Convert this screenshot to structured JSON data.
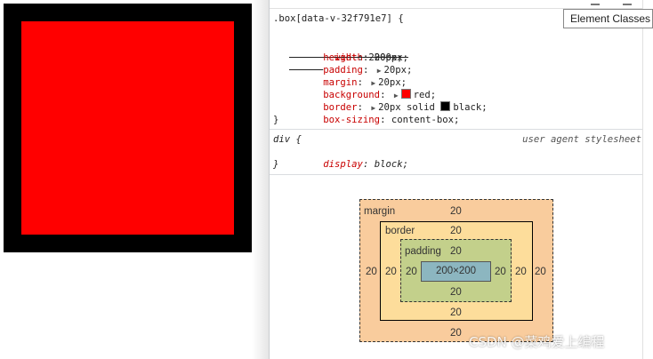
{
  "preview": {
    "box_background": "#ff0000",
    "box_border_color": "#000000"
  },
  "styles": {
    "rule1": {
      "selector": ".box[data-v-32f791e7] {",
      "declarations": [
        {
          "prop": "width",
          "value": "200px;",
          "overridden": true
        },
        {
          "prop": "height",
          "value": "200px;"
        },
        {
          "prop": "padding",
          "value": "20px;",
          "expandable": true
        },
        {
          "prop": "margin",
          "value": "20px;",
          "expandable": true
        },
        {
          "prop": "background",
          "value": "red;",
          "expandable": true,
          "swatch": "#ff0000"
        },
        {
          "prop": "border",
          "value_pre": "20px solid ",
          "value": "black;",
          "expandable": true,
          "swatch": "#000000"
        },
        {
          "prop": "box-sizing",
          "value": "content-box;"
        }
      ],
      "close": "}"
    },
    "rule2": {
      "selector": "div {",
      "origin": "user agent stylesheet",
      "declarations": [
        {
          "prop": "display",
          "value": "block;"
        }
      ],
      "close": "}"
    }
  },
  "tooltip": {
    "text": "Element Classes"
  },
  "box_model": {
    "margin": {
      "label": "margin",
      "top": "20",
      "right": "20",
      "bottom": "20",
      "left": "20"
    },
    "border": {
      "label": "border",
      "top": "20",
      "right": "20",
      "bottom": "20",
      "left": "20"
    },
    "padding": {
      "label": "padding",
      "top": "20",
      "right": "20",
      "bottom": "20",
      "left": "20"
    },
    "content": {
      "size": "200×200"
    }
  },
  "watermark": "CSDN @菜鸡爱上编程"
}
